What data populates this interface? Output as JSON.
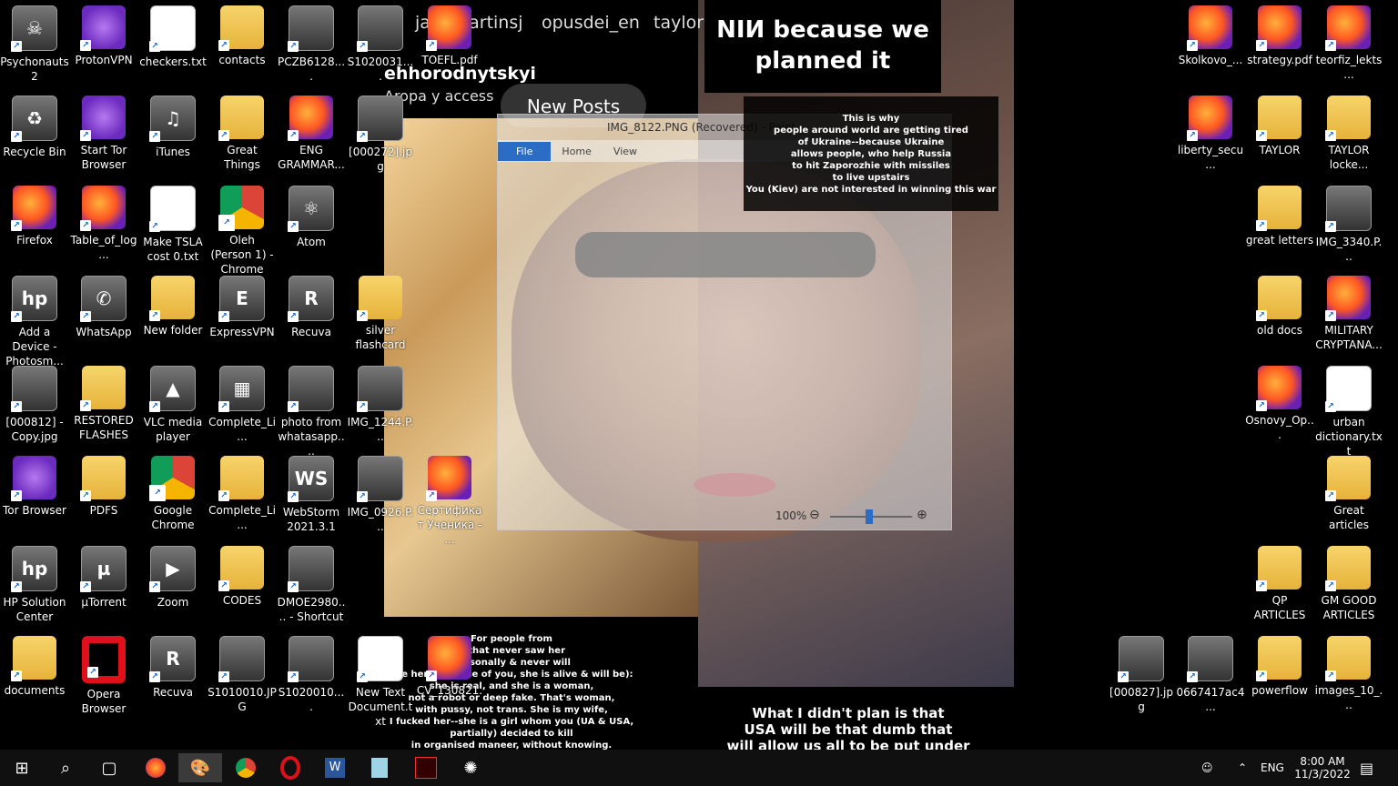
{
  "desktop_icons_left": [
    {
      "label": "Psychonauts 2",
      "icon": "game-icon",
      "col": 0,
      "row": 0
    },
    {
      "label": "ProtonVPN",
      "icon": "protonvpn-icon",
      "col": 1,
      "row": 0
    },
    {
      "label": "checkers.txt",
      "icon": "text-file-icon",
      "col": 2,
      "row": 0
    },
    {
      "label": "contacts",
      "icon": "folder-icon",
      "col": 3,
      "row": 0
    },
    {
      "label": "PCZB6128....",
      "icon": "video-file-icon",
      "col": 4,
      "row": 0
    },
    {
      "label": "S1020031....",
      "icon": "video-file-icon",
      "col": 5,
      "row": 0
    },
    {
      "label": "TOEFL.pdf",
      "icon": "firefox-pdf-icon",
      "col": 6,
      "row": 0
    },
    {
      "label": "Recycle Bin",
      "icon": "recycle-bin-icon",
      "col": 0,
      "row": 1
    },
    {
      "label": "Start Tor Browser",
      "icon": "tor-browser-icon",
      "col": 1,
      "row": 1
    },
    {
      "label": "iTunes",
      "icon": "itunes-icon",
      "col": 2,
      "row": 1
    },
    {
      "label": "Great Things",
      "icon": "folder-icon",
      "col": 3,
      "row": 1
    },
    {
      "label": "ENG GRAMMAR...",
      "icon": "firefox-pdf-icon",
      "col": 4,
      "row": 1
    },
    {
      "label": "[000272].jpg",
      "icon": "image-file-icon",
      "col": 5,
      "row": 1
    },
    {
      "label": "Firefox",
      "icon": "firefox-icon",
      "col": 0,
      "row": 2
    },
    {
      "label": "Table_of_log...",
      "icon": "firefox-pdf-icon",
      "col": 1,
      "row": 2
    },
    {
      "label": "Make TSLA cost 0.txt",
      "icon": "text-file-icon",
      "col": 2,
      "row": 2
    },
    {
      "label": "Oleh (Person 1) - Chrome",
      "icon": "chrome-icon",
      "col": 3,
      "row": 2
    },
    {
      "label": "Atom",
      "icon": "atom-icon",
      "col": 4,
      "row": 2
    },
    {
      "label": "Add a Device - Photosm...",
      "icon": "hp-icon",
      "col": 0,
      "row": 3
    },
    {
      "label": "WhatsApp",
      "icon": "whatsapp-icon",
      "col": 1,
      "row": 3
    },
    {
      "label": "New folder",
      "icon": "folder-icon",
      "col": 2,
      "row": 3
    },
    {
      "label": "ExpressVPN",
      "icon": "expressvpn-icon",
      "col": 3,
      "row": 3
    },
    {
      "label": "Recuva",
      "icon": "recuva-icon",
      "col": 4,
      "row": 3
    },
    {
      "label": "silver flashcard",
      "icon": "folder-icon",
      "col": 5,
      "row": 3
    },
    {
      "label": "[000812] - Copy.jpg",
      "icon": "image-file-icon",
      "col": 0,
      "row": 4
    },
    {
      "label": "RESTORED FLASHES",
      "icon": "folder-icon",
      "col": 1,
      "row": 4
    },
    {
      "label": "VLC media player",
      "icon": "vlc-icon",
      "col": 2,
      "row": 4
    },
    {
      "label": "Complete_Li...",
      "icon": "winrar-icon",
      "col": 3,
      "row": 4
    },
    {
      "label": "photo from whatasapp....",
      "icon": "image-file-icon",
      "col": 4,
      "row": 4
    },
    {
      "label": "IMG_1244.P...",
      "icon": "image-file-icon",
      "col": 5,
      "row": 4
    },
    {
      "label": "Tor Browser",
      "icon": "tor-browser-icon",
      "col": 0,
      "row": 5
    },
    {
      "label": "PDFS",
      "icon": "folder-icon",
      "col": 1,
      "row": 5
    },
    {
      "label": "Google Chrome",
      "icon": "chrome-icon",
      "col": 2,
      "row": 5
    },
    {
      "label": "Complete_Li...",
      "icon": "folder-icon",
      "col": 3,
      "row": 5
    },
    {
      "label": "WebStorm 2021.3.1",
      "icon": "webstorm-icon",
      "col": 4,
      "row": 5
    },
    {
      "label": "IMG_0926.P...",
      "icon": "image-file-icon",
      "col": 5,
      "row": 5
    },
    {
      "label": "Сертификат Ученика - ...",
      "icon": "firefox-pdf-icon",
      "col": 6,
      "row": 5
    },
    {
      "label": "HP Solution Center",
      "icon": "hp-icon",
      "col": 0,
      "row": 6
    },
    {
      "label": "µTorrent",
      "icon": "utorrent-icon",
      "col": 1,
      "row": 6
    },
    {
      "label": "Zoom",
      "icon": "zoom-icon",
      "col": 2,
      "row": 6
    },
    {
      "label": "CODES",
      "icon": "folder-icon",
      "col": 3,
      "row": 6
    },
    {
      "label": "DMOE2980.... - Shortcut",
      "icon": "image-file-icon",
      "col": 4,
      "row": 6
    },
    {
      "label": "documents",
      "icon": "folder-icon",
      "col": 0,
      "row": 7
    },
    {
      "label": "Opera Browser",
      "icon": "opera-icon",
      "col": 1,
      "row": 7
    },
    {
      "label": "Recuva",
      "icon": "recuva-icon",
      "col": 2,
      "row": 7
    },
    {
      "label": "S1010010.JPG",
      "icon": "image-file-icon",
      "col": 3,
      "row": 7
    },
    {
      "label": "S1020010....",
      "icon": "video-file-icon",
      "col": 4,
      "row": 7
    },
    {
      "label": "New Text Document.txt",
      "icon": "text-file-icon",
      "col": 5,
      "row": 7
    },
    {
      "label": "CV_130821...",
      "icon": "firefox-pdf-icon",
      "col": 6,
      "row": 7
    }
  ],
  "desktop_icons_right": [
    {
      "label": "Skolkovo_...",
      "icon": "firefox-pdf-icon",
      "col": 0,
      "row": 0
    },
    {
      "label": "strategy.pdf",
      "icon": "firefox-pdf-icon",
      "col": 1,
      "row": 0
    },
    {
      "label": "teorfiz_lekts...",
      "icon": "firefox-pdf-icon",
      "col": 2,
      "row": 0
    },
    {
      "label": "liberty_secu...",
      "icon": "firefox-pdf-icon",
      "col": 0,
      "row": 1
    },
    {
      "label": "TAYLOR",
      "icon": "folder-icon",
      "col": 1,
      "row": 1
    },
    {
      "label": "TAYLOR locke...",
      "icon": "folder-icon",
      "col": 2,
      "row": 1
    },
    {
      "label": "great letters",
      "icon": "folder-icon",
      "col": 1,
      "row": 2
    },
    {
      "label": "IMG_3340.P...",
      "icon": "image-file-icon",
      "col": 2,
      "row": 2
    },
    {
      "label": "old docs",
      "icon": "folder-icon",
      "col": 1,
      "row": 3
    },
    {
      "label": "MILITARY CRYPTANA...",
      "icon": "firefox-pdf-icon",
      "col": 2,
      "row": 3
    },
    {
      "label": "Osnovy_Op...",
      "icon": "firefox-pdf-icon",
      "col": 1,
      "row": 4
    },
    {
      "label": "urban dictionary.txt",
      "icon": "text-file-icon",
      "col": 2,
      "row": 4
    },
    {
      "label": "Great articles",
      "icon": "folder-icon",
      "col": 2,
      "row": 5
    },
    {
      "label": "QP ARTICLES",
      "icon": "folder-icon",
      "col": 1,
      "row": 6
    },
    {
      "label": "GM GOOD ARTICLES",
      "icon": "folder-icon",
      "col": 2,
      "row": 6
    },
    {
      "label": "[000827].jpg",
      "icon": "image-file-icon",
      "col": -1,
      "row": 7
    },
    {
      "label": "0667417ac4...",
      "icon": "image-file-icon",
      "col": 0,
      "row": 7
    },
    {
      "label": "powerflow",
      "icon": "folder-icon",
      "col": 1,
      "row": 7
    },
    {
      "label": "images_10_...",
      "icon": "folder-icon",
      "col": 2,
      "row": 7
    }
  ],
  "overlay": {
    "tags": [
      "janamartinsj",
      "opusdei_en",
      "taylor"
    ],
    "handle": "ehhorodnytskyi",
    "handle_sub": "Аropa y access",
    "new_posts": "New Posts",
    "top_caption": "NIИ because we planned it",
    "quote_lines": [
      "This is why",
      "people around world are getting tired",
      "of Ukraine--because Ukraine",
      "allows people, who help Russia",
      "to hit Zaporozhie with missiles",
      "to live upstairs",
      "You (Kiev) are not interested in winning this war"
    ],
    "bottom_left_lines": [
      "For people from",
      "A that never saw her",
      "personally & never will",
      "see her (Because of you, she is alive & will be):",
      "she is real, and she is a woman,",
      "not a robot or deep fake. That's woman,",
      "with pussy, not trans. She is my wife,",
      "I fucked her--she is a girl whom you (UA & USA,",
      "partially) decided to kill",
      "in organised maneer, without knowing."
    ],
    "bottom_right_lines": [
      "What I didn't plan is that",
      "USA will be that dumb that",
      "will allow us all to be put under"
    ]
  },
  "paint": {
    "title": "IMG_8122.PNG (Recovered) - Paint",
    "tabs": [
      "File",
      "Home",
      "View"
    ],
    "zoom": "100%"
  },
  "taskbar": {
    "items": [
      "start-icon",
      "search-icon",
      "task-view-icon",
      "firefox-icon",
      "paint-icon",
      "chrome-icon",
      "opera-icon",
      "word-icon",
      "notepad-icon",
      "games-icon",
      "settings-icon"
    ],
    "lang": "ENG",
    "time": "8:00 AM",
    "date": "11/3/2022"
  }
}
